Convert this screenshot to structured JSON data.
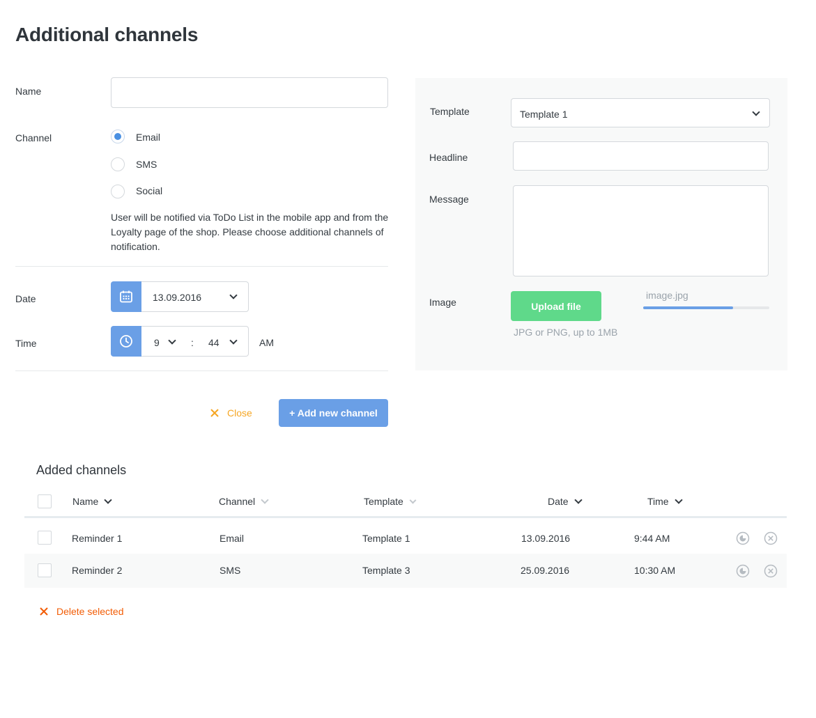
{
  "page": {
    "title": "Additional channels"
  },
  "form": {
    "name_label": "Name",
    "name_value": "",
    "channel_label": "Channel",
    "channels": [
      {
        "label": "Email",
        "checked": true
      },
      {
        "label": "SMS",
        "checked": false
      },
      {
        "label": "Social",
        "checked": false
      }
    ],
    "help_text": "User will be notified via ToDo List in the mobile app and from the Loyalty page of the shop. Please choose additional channels of notification.",
    "date_label": "Date",
    "date_value": "13.09.2016",
    "time_label": "Time",
    "time_hour": "9",
    "time_separator": ":",
    "time_minute": "44",
    "time_ampm": "AM"
  },
  "panel": {
    "template_label": "Template",
    "template_value": "Template 1",
    "headline_label": "Headline",
    "headline_value": "",
    "message_label": "Message",
    "message_value": "",
    "image_label": "Image",
    "upload_label": "Upload file",
    "upload_hint": "JPG or PNG, up to 1MB",
    "file_name": "image.jpg",
    "upload_progress": 0.71
  },
  "actions": {
    "close_label": "Close",
    "add_label": "+ Add new channel"
  },
  "table": {
    "title": "Added channels",
    "columns": [
      "Name",
      "Channel",
      "Template",
      "Date",
      "Time"
    ],
    "rows": [
      {
        "name": "Reminder 1",
        "channel": "Email",
        "template": "Template 1",
        "date": "13.09.2016",
        "time": "9:44 AM"
      },
      {
        "name": "Reminder 2",
        "channel": "SMS",
        "template": "Template 3",
        "date": "25.09.2016",
        "time": "10:30 AM"
      }
    ],
    "delete_label": "Delete selected"
  },
  "colors": {
    "accent_blue": "#6a9fe6",
    "success_green": "#5fd98a",
    "close_orange": "#f5a623",
    "delete_orange": "#f25c05"
  }
}
